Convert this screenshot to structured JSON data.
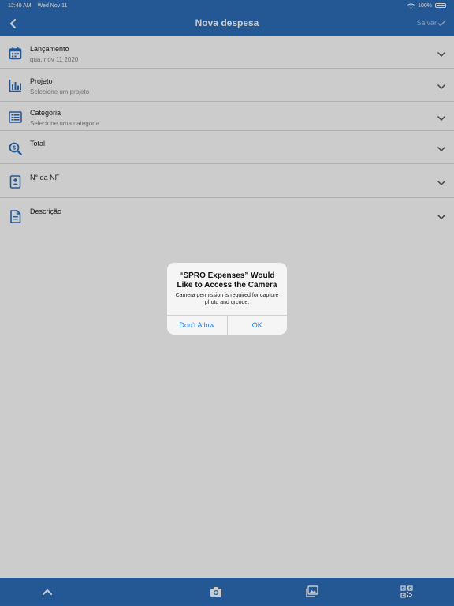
{
  "status_bar": {
    "time": "12:40 AM",
    "date": "Wed Nov 11",
    "battery": "100%"
  },
  "nav": {
    "title": "Nova despesa",
    "save_label": "Salvar",
    "back_icon": "chevron-left-icon"
  },
  "form": {
    "rows": [
      {
        "label": "Lançamento",
        "value": "qua, nov 11 2020",
        "icon": "calendar-icon"
      },
      {
        "label": "Projeto",
        "value": "Selecione um projeto",
        "icon": "bar-chart-icon"
      },
      {
        "label": "Categoria",
        "value": "Selecione uma categoria",
        "icon": "list-icon"
      },
      {
        "label": "Total",
        "value": "",
        "icon": "money-search-icon"
      },
      {
        "label": "N° da NF",
        "value": "",
        "icon": "id-badge-icon"
      },
      {
        "label": "Descrição",
        "value": "",
        "icon": "document-icon"
      }
    ]
  },
  "alert": {
    "title": "“SPRO Expenses” Would Like to Access the Camera",
    "message": "Camera permission is required for capture photo and qrcode.",
    "deny_label": "Don’t Allow",
    "ok_label": "OK"
  },
  "toolbar": {
    "items": [
      "chevron-up-icon",
      "camera-icon",
      "gallery-icon",
      "qrcode-icon"
    ]
  },
  "colors": {
    "primary": "#2c6fbb",
    "link": "#1a7ae8",
    "save_disabled": "#a8c4e6"
  }
}
